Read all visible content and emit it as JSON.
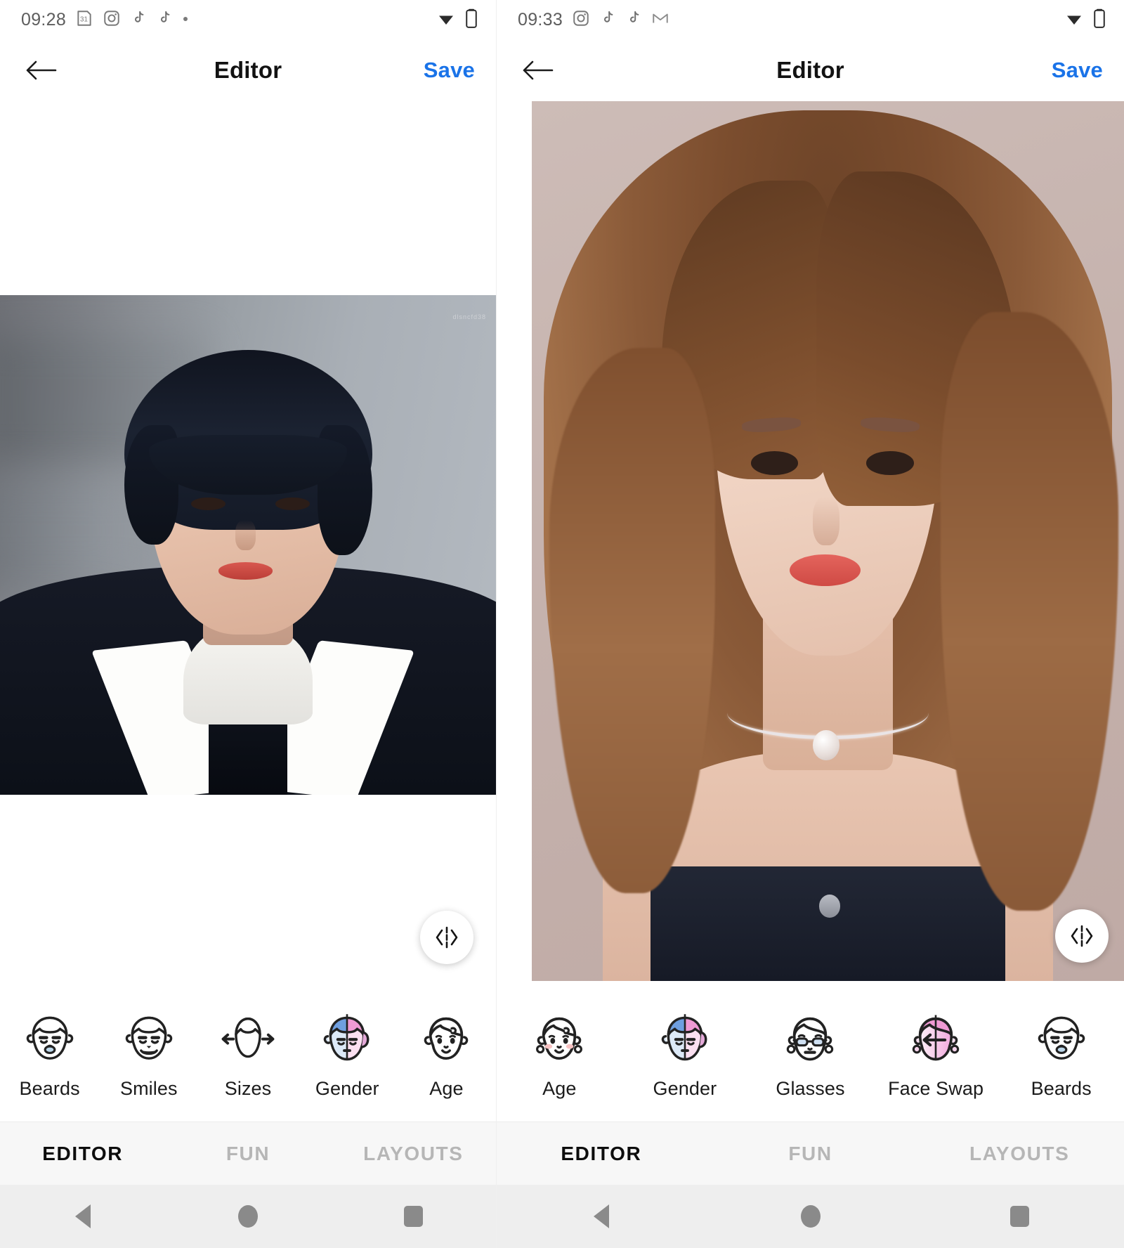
{
  "screens": [
    {
      "id": "left",
      "statusbar": {
        "time": "09:28",
        "icons": [
          "calendar-31-icon",
          "instagram-icon",
          "tiktok-icon",
          "tiktok-icon",
          "dot-icon"
        ],
        "right_icons": [
          "wifi-icon",
          "battery-icon"
        ]
      },
      "appbar": {
        "back_icon": "arrow-left-icon",
        "title": "Editor",
        "save_label": "Save",
        "save_color": "#1a73e8"
      },
      "canvas": {
        "compare_button_icon": "compare-split-icon",
        "photo_alt": "male-portrait"
      },
      "tools": [
        {
          "label": "Beards",
          "icon": "face-beard-icon"
        },
        {
          "label": "Smiles",
          "icon": "face-smile-icon"
        },
        {
          "label": "Sizes",
          "icon": "face-resize-arrows-icon"
        },
        {
          "label": "Gender",
          "icon": "face-gender-split-icon"
        },
        {
          "label": "Age",
          "icon": "face-child-icon"
        }
      ],
      "tabs": [
        {
          "label": "EDITOR",
          "active": true
        },
        {
          "label": "FUN",
          "active": false
        },
        {
          "label": "LAYOUTS",
          "active": false
        }
      ],
      "navbar": [
        "back-triangle-icon",
        "home-circle-icon",
        "recents-square-icon"
      ]
    },
    {
      "id": "right",
      "statusbar": {
        "time": "09:33",
        "icons": [
          "instagram-icon",
          "tiktok-icon",
          "tiktok-icon",
          "gmail-icon"
        ],
        "right_icons": [
          "wifi-icon",
          "battery-icon"
        ]
      },
      "appbar": {
        "back_icon": "arrow-left-icon",
        "title": "Editor",
        "save_label": "Save",
        "save_color": "#1a73e8"
      },
      "canvas": {
        "compare_button_icon": "compare-split-icon",
        "photo_alt": "female-portrait"
      },
      "tools": [
        {
          "label": "Age",
          "icon": "face-child-girl-icon"
        },
        {
          "label": "Gender",
          "icon": "face-gender-split-icon"
        },
        {
          "label": "Glasses",
          "icon": "face-glasses-icon"
        },
        {
          "label": "Face Swap",
          "icon": "face-swap-arrow-icon"
        },
        {
          "label": "Beards",
          "icon": "face-beard-icon"
        }
      ],
      "tabs": [
        {
          "label": "EDITOR",
          "active": true
        },
        {
          "label": "FUN",
          "active": false
        },
        {
          "label": "LAYOUTS",
          "active": false
        }
      ],
      "navbar": [
        "back-triangle-icon",
        "home-circle-icon",
        "recents-square-icon"
      ]
    }
  ],
  "theme": {
    "accent": "#1a73e8",
    "tab_active": "#0d0d0d",
    "tab_inactive": "#b6b6b6",
    "status_text": "#5d5d5d",
    "icon_outline": "#2b2b2b",
    "gender_blue": "#8fb4e8",
    "gender_pink": "#f0a9d8",
    "beard_blue": "#bcd7ea",
    "glasses_blue": "#cfe0f2"
  }
}
